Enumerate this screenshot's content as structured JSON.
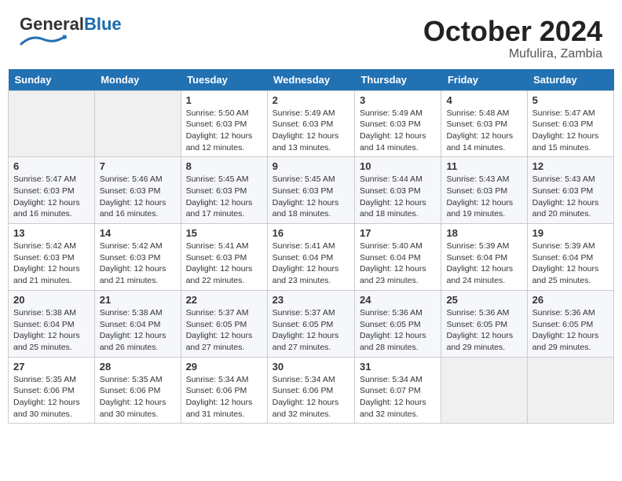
{
  "header": {
    "logo_text_general": "General",
    "logo_text_blue": "Blue",
    "month": "October 2024",
    "location": "Mufulira, Zambia"
  },
  "days_of_week": [
    "Sunday",
    "Monday",
    "Tuesday",
    "Wednesday",
    "Thursday",
    "Friday",
    "Saturday"
  ],
  "weeks": [
    [
      {
        "day": "",
        "info": ""
      },
      {
        "day": "",
        "info": ""
      },
      {
        "day": "1",
        "info": "Sunrise: 5:50 AM\nSunset: 6:03 PM\nDaylight: 12 hours and 12 minutes."
      },
      {
        "day": "2",
        "info": "Sunrise: 5:49 AM\nSunset: 6:03 PM\nDaylight: 12 hours and 13 minutes."
      },
      {
        "day": "3",
        "info": "Sunrise: 5:49 AM\nSunset: 6:03 PM\nDaylight: 12 hours and 14 minutes."
      },
      {
        "day": "4",
        "info": "Sunrise: 5:48 AM\nSunset: 6:03 PM\nDaylight: 12 hours and 14 minutes."
      },
      {
        "day": "5",
        "info": "Sunrise: 5:47 AM\nSunset: 6:03 PM\nDaylight: 12 hours and 15 minutes."
      }
    ],
    [
      {
        "day": "6",
        "info": "Sunrise: 5:47 AM\nSunset: 6:03 PM\nDaylight: 12 hours and 16 minutes."
      },
      {
        "day": "7",
        "info": "Sunrise: 5:46 AM\nSunset: 6:03 PM\nDaylight: 12 hours and 16 minutes."
      },
      {
        "day": "8",
        "info": "Sunrise: 5:45 AM\nSunset: 6:03 PM\nDaylight: 12 hours and 17 minutes."
      },
      {
        "day": "9",
        "info": "Sunrise: 5:45 AM\nSunset: 6:03 PM\nDaylight: 12 hours and 18 minutes."
      },
      {
        "day": "10",
        "info": "Sunrise: 5:44 AM\nSunset: 6:03 PM\nDaylight: 12 hours and 18 minutes."
      },
      {
        "day": "11",
        "info": "Sunrise: 5:43 AM\nSunset: 6:03 PM\nDaylight: 12 hours and 19 minutes."
      },
      {
        "day": "12",
        "info": "Sunrise: 5:43 AM\nSunset: 6:03 PM\nDaylight: 12 hours and 20 minutes."
      }
    ],
    [
      {
        "day": "13",
        "info": "Sunrise: 5:42 AM\nSunset: 6:03 PM\nDaylight: 12 hours and 21 minutes."
      },
      {
        "day": "14",
        "info": "Sunrise: 5:42 AM\nSunset: 6:03 PM\nDaylight: 12 hours and 21 minutes."
      },
      {
        "day": "15",
        "info": "Sunrise: 5:41 AM\nSunset: 6:03 PM\nDaylight: 12 hours and 22 minutes."
      },
      {
        "day": "16",
        "info": "Sunrise: 5:41 AM\nSunset: 6:04 PM\nDaylight: 12 hours and 23 minutes."
      },
      {
        "day": "17",
        "info": "Sunrise: 5:40 AM\nSunset: 6:04 PM\nDaylight: 12 hours and 23 minutes."
      },
      {
        "day": "18",
        "info": "Sunrise: 5:39 AM\nSunset: 6:04 PM\nDaylight: 12 hours and 24 minutes."
      },
      {
        "day": "19",
        "info": "Sunrise: 5:39 AM\nSunset: 6:04 PM\nDaylight: 12 hours and 25 minutes."
      }
    ],
    [
      {
        "day": "20",
        "info": "Sunrise: 5:38 AM\nSunset: 6:04 PM\nDaylight: 12 hours and 25 minutes."
      },
      {
        "day": "21",
        "info": "Sunrise: 5:38 AM\nSunset: 6:04 PM\nDaylight: 12 hours and 26 minutes."
      },
      {
        "day": "22",
        "info": "Sunrise: 5:37 AM\nSunset: 6:05 PM\nDaylight: 12 hours and 27 minutes."
      },
      {
        "day": "23",
        "info": "Sunrise: 5:37 AM\nSunset: 6:05 PM\nDaylight: 12 hours and 27 minutes."
      },
      {
        "day": "24",
        "info": "Sunrise: 5:36 AM\nSunset: 6:05 PM\nDaylight: 12 hours and 28 minutes."
      },
      {
        "day": "25",
        "info": "Sunrise: 5:36 AM\nSunset: 6:05 PM\nDaylight: 12 hours and 29 minutes."
      },
      {
        "day": "26",
        "info": "Sunrise: 5:36 AM\nSunset: 6:05 PM\nDaylight: 12 hours and 29 minutes."
      }
    ],
    [
      {
        "day": "27",
        "info": "Sunrise: 5:35 AM\nSunset: 6:06 PM\nDaylight: 12 hours and 30 minutes."
      },
      {
        "day": "28",
        "info": "Sunrise: 5:35 AM\nSunset: 6:06 PM\nDaylight: 12 hours and 30 minutes."
      },
      {
        "day": "29",
        "info": "Sunrise: 5:34 AM\nSunset: 6:06 PM\nDaylight: 12 hours and 31 minutes."
      },
      {
        "day": "30",
        "info": "Sunrise: 5:34 AM\nSunset: 6:06 PM\nDaylight: 12 hours and 32 minutes."
      },
      {
        "day": "31",
        "info": "Sunrise: 5:34 AM\nSunset: 6:07 PM\nDaylight: 12 hours and 32 minutes."
      },
      {
        "day": "",
        "info": ""
      },
      {
        "day": "",
        "info": ""
      }
    ]
  ]
}
